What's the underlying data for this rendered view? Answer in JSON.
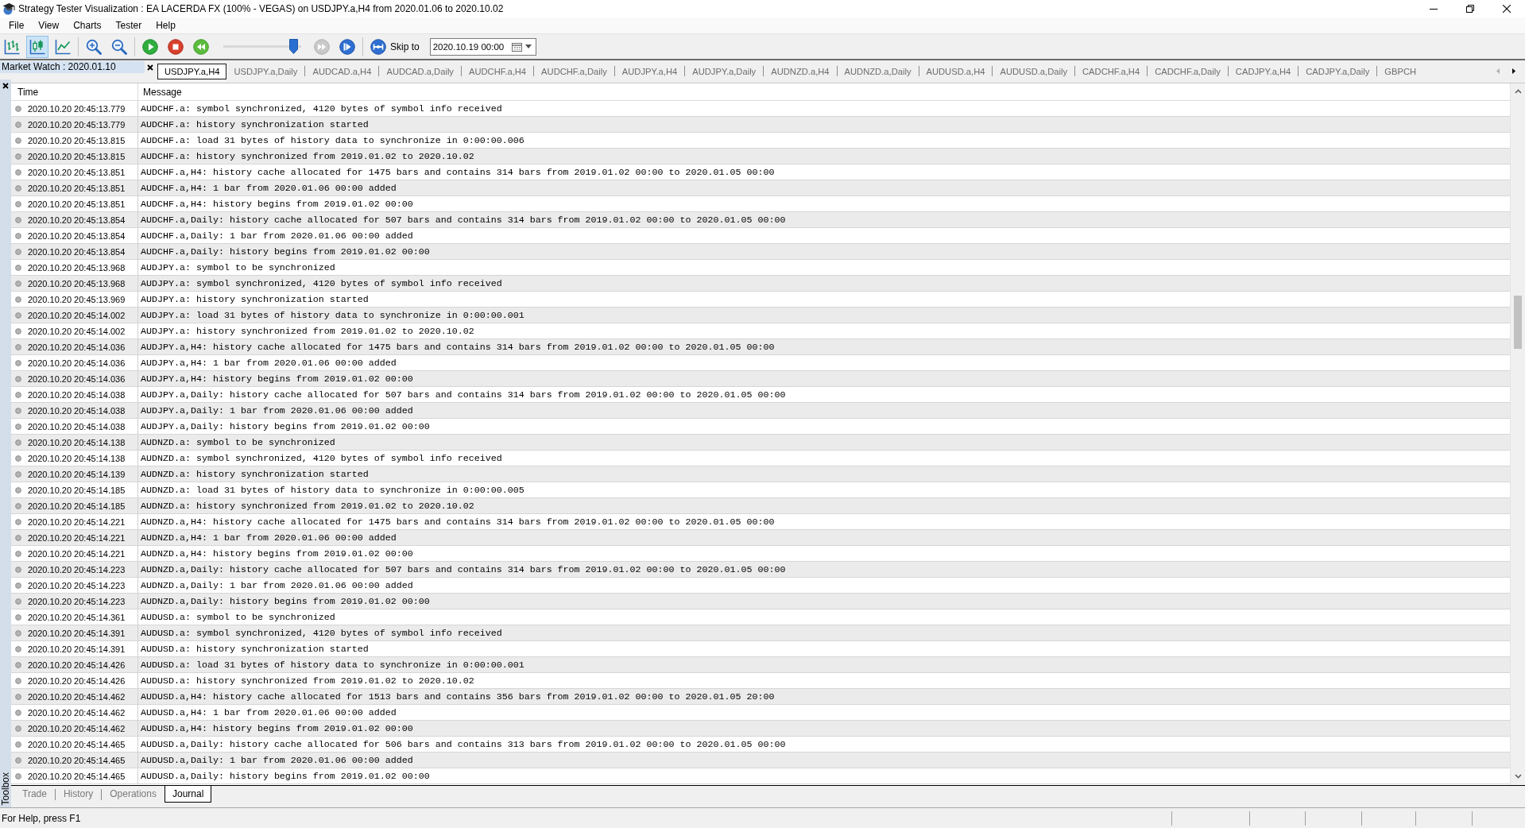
{
  "window": {
    "title": "Strategy Tester Visualization : EA LACERDA FX (100% - VEGAS) on USDJPY.a,H4 from 2020.01.06 to 2020.10.02"
  },
  "menu": [
    "File",
    "View",
    "Charts",
    "Tester",
    "Help"
  ],
  "toolbar": {
    "chart_modes": [
      {
        "kind": "bars",
        "selected": false
      },
      {
        "kind": "candles",
        "selected": true
      },
      {
        "kind": "line",
        "selected": false
      }
    ],
    "zoom_buttons": [
      {
        "kind": "zoom-in"
      },
      {
        "kind": "zoom-out"
      }
    ],
    "playback": [
      {
        "kind": "play",
        "disabled": false
      },
      {
        "kind": "stop",
        "disabled": false
      },
      {
        "kind": "rewind",
        "disabled": false
      }
    ],
    "speed_slider": {
      "level": 0.95
    },
    "stepping": [
      {
        "kind": "fast-forward",
        "disabled": true
      },
      {
        "kind": "step",
        "disabled": false
      }
    ],
    "skip_button": {
      "label": "Skip to"
    },
    "skip_date": {
      "value": "2020.10.19 00:00"
    }
  },
  "market_watch": {
    "title": "Market Watch : 2020.01.10"
  },
  "chart_tabs": [
    {
      "label": "USDJPY.a,H4",
      "selected": true
    },
    {
      "label": "USDJPY.a,Daily",
      "selected": false
    },
    {
      "label": "AUDCAD.a,H4",
      "selected": false
    },
    {
      "label": "AUDCAD.a,Daily",
      "selected": false
    },
    {
      "label": "AUDCHF.a,H4",
      "selected": false
    },
    {
      "label": "AUDCHF.a,Daily",
      "selected": false
    },
    {
      "label": "AUDJPY.a,H4",
      "selected": false
    },
    {
      "label": "AUDJPY.a,Daily",
      "selected": false
    },
    {
      "label": "AUDNZD.a,H4",
      "selected": false
    },
    {
      "label": "AUDNZD.a,Daily",
      "selected": false
    },
    {
      "label": "AUDUSD.a,H4",
      "selected": false
    },
    {
      "label": "AUDUSD.a,Daily",
      "selected": false
    },
    {
      "label": "CADCHF.a,H4",
      "selected": false
    },
    {
      "label": "CADCHF.a,Daily",
      "selected": false
    },
    {
      "label": "CADJPY.a,H4",
      "selected": false
    },
    {
      "label": "CADJPY.a,Daily",
      "selected": false
    },
    {
      "label": "GBPCH",
      "selected": false
    }
  ],
  "tab_scroll": [
    {
      "kind": "left",
      "disabled": true
    },
    {
      "kind": "right",
      "disabled": false
    }
  ],
  "journal": {
    "columns": [
      "Time",
      "Message"
    ],
    "rows": [
      {
        "time": "2020.10.20 20:45:13.779",
        "message": "AUDCHF.a: symbol synchronized, 4120 bytes of symbol info received"
      },
      {
        "time": "2020.10.20 20:45:13.779",
        "message": "AUDCHF.a: history synchronization started"
      },
      {
        "time": "2020.10.20 20:45:13.815",
        "message": "AUDCHF.a: load 31 bytes of history data to synchronize in 0:00:00.006"
      },
      {
        "time": "2020.10.20 20:45:13.815",
        "message": "AUDCHF.a: history synchronized from 2019.01.02 to 2020.10.02"
      },
      {
        "time": "2020.10.20 20:45:13.851",
        "message": "AUDCHF.a,H4: history cache allocated for 1475 bars and contains 314 bars from 2019.01.02 00:00 to 2020.01.05 00:00"
      },
      {
        "time": "2020.10.20 20:45:13.851",
        "message": "AUDCHF.a,H4: 1 bar from 2020.01.06 00:00 added"
      },
      {
        "time": "2020.10.20 20:45:13.851",
        "message": "AUDCHF.a,H4: history begins from 2019.01.02 00:00"
      },
      {
        "time": "2020.10.20 20:45:13.854",
        "message": "AUDCHF.a,Daily: history cache allocated for 507 bars and contains 314 bars from 2019.01.02 00:00 to 2020.01.05 00:00"
      },
      {
        "time": "2020.10.20 20:45:13.854",
        "message": "AUDCHF.a,Daily: 1 bar from 2020.01.06 00:00 added"
      },
      {
        "time": "2020.10.20 20:45:13.854",
        "message": "AUDCHF.a,Daily: history begins from 2019.01.02 00:00"
      },
      {
        "time": "2020.10.20 20:45:13.968",
        "message": "AUDJPY.a: symbol to be synchronized"
      },
      {
        "time": "2020.10.20 20:45:13.968",
        "message": "AUDJPY.a: symbol synchronized, 4120 bytes of symbol info received"
      },
      {
        "time": "2020.10.20 20:45:13.969",
        "message": "AUDJPY.a: history synchronization started"
      },
      {
        "time": "2020.10.20 20:45:14.002",
        "message": "AUDJPY.a: load 31 bytes of history data to synchronize in 0:00:00.001"
      },
      {
        "time": "2020.10.20 20:45:14.002",
        "message": "AUDJPY.a: history synchronized from 2019.01.02 to 2020.10.02"
      },
      {
        "time": "2020.10.20 20:45:14.036",
        "message": "AUDJPY.a,H4: history cache allocated for 1475 bars and contains 314 bars from 2019.01.02 00:00 to 2020.01.05 00:00"
      },
      {
        "time": "2020.10.20 20:45:14.036",
        "message": "AUDJPY.a,H4: 1 bar from 2020.01.06 00:00 added"
      },
      {
        "time": "2020.10.20 20:45:14.036",
        "message": "AUDJPY.a,H4: history begins from 2019.01.02 00:00"
      },
      {
        "time": "2020.10.20 20:45:14.038",
        "message": "AUDJPY.a,Daily: history cache allocated for 507 bars and contains 314 bars from 2019.01.02 00:00 to 2020.01.05 00:00"
      },
      {
        "time": "2020.10.20 20:45:14.038",
        "message": "AUDJPY.a,Daily: 1 bar from 2020.01.06 00:00 added"
      },
      {
        "time": "2020.10.20 20:45:14.038",
        "message": "AUDJPY.a,Daily: history begins from 2019.01.02 00:00"
      },
      {
        "time": "2020.10.20 20:45:14.138",
        "message": "AUDNZD.a: symbol to be synchronized"
      },
      {
        "time": "2020.10.20 20:45:14.138",
        "message": "AUDNZD.a: symbol synchronized, 4120 bytes of symbol info received"
      },
      {
        "time": "2020.10.20 20:45:14.139",
        "message": "AUDNZD.a: history synchronization started"
      },
      {
        "time": "2020.10.20 20:45:14.185",
        "message": "AUDNZD.a: load 31 bytes of history data to synchronize in 0:00:00.005"
      },
      {
        "time": "2020.10.20 20:45:14.185",
        "message": "AUDNZD.a: history synchronized from 2019.01.02 to 2020.10.02"
      },
      {
        "time": "2020.10.20 20:45:14.221",
        "message": "AUDNZD.a,H4: history cache allocated for 1475 bars and contains 314 bars from 2019.01.02 00:00 to 2020.01.05 00:00"
      },
      {
        "time": "2020.10.20 20:45:14.221",
        "message": "AUDNZD.a,H4: 1 bar from 2020.01.06 00:00 added"
      },
      {
        "time": "2020.10.20 20:45:14.221",
        "message": "AUDNZD.a,H4: history begins from 2019.01.02 00:00"
      },
      {
        "time": "2020.10.20 20:45:14.223",
        "message": "AUDNZD.a,Daily: history cache allocated for 507 bars and contains 314 bars from 2019.01.02 00:00 to 2020.01.05 00:00"
      },
      {
        "time": "2020.10.20 20:45:14.223",
        "message": "AUDNZD.a,Daily: 1 bar from 2020.01.06 00:00 added"
      },
      {
        "time": "2020.10.20 20:45:14.223",
        "message": "AUDNZD.a,Daily: history begins from 2019.01.02 00:00"
      },
      {
        "time": "2020.10.20 20:45:14.361",
        "message": "AUDUSD.a: symbol to be synchronized"
      },
      {
        "time": "2020.10.20 20:45:14.391",
        "message": "AUDUSD.a: symbol synchronized, 4120 bytes of symbol info received"
      },
      {
        "time": "2020.10.20 20:45:14.391",
        "message": "AUDUSD.a: history synchronization started"
      },
      {
        "time": "2020.10.20 20:45:14.426",
        "message": "AUDUSD.a: load 31 bytes of history data to synchronize in 0:00:00.001"
      },
      {
        "time": "2020.10.20 20:45:14.426",
        "message": "AUDUSD.a: history synchronized from 2019.01.02 to 2020.10.02"
      },
      {
        "time": "2020.10.20 20:45:14.462",
        "message": "AUDUSD.a,H4: history cache allocated for 1513 bars and contains 356 bars from 2019.01.02 00:00 to 2020.01.05 20:00"
      },
      {
        "time": "2020.10.20 20:45:14.462",
        "message": "AUDUSD.a,H4: 1 bar from 2020.01.06 00:00 added"
      },
      {
        "time": "2020.10.20 20:45:14.462",
        "message": "AUDUSD.a,H4: history begins from 2019.01.02 00:00"
      },
      {
        "time": "2020.10.20 20:45:14.465",
        "message": "AUDUSD.a,Daily: history cache allocated for 506 bars and contains 313 bars from 2019.01.02 00:00 to 2020.01.05 00:00"
      },
      {
        "time": "2020.10.20 20:45:14.465",
        "message": "AUDUSD.a,Daily: 1 bar from 2020.01.06 00:00 added"
      },
      {
        "time": "2020.10.20 20:45:14.465",
        "message": "AUDUSD.a,Daily: history begins from 2019.01.02 00:00"
      }
    ]
  },
  "bottom_tabs": [
    {
      "label": "Trade",
      "selected": false
    },
    {
      "label": "History",
      "selected": false
    },
    {
      "label": "Operations",
      "selected": false
    },
    {
      "label": "Journal",
      "selected": true
    }
  ],
  "toolbox": {
    "label": "Toolbox"
  },
  "status_bar": {
    "text": "For Help, press F1"
  }
}
